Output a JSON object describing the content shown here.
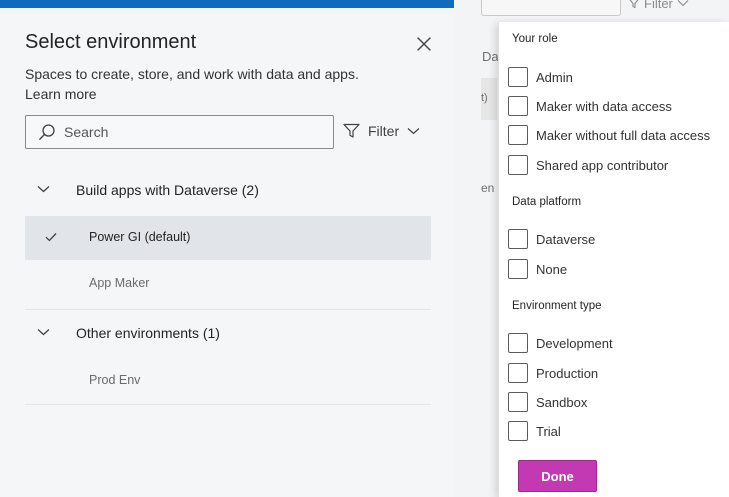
{
  "background": {
    "filter_label": "Filter",
    "column_header_fragment": "Da",
    "row_fragment_a": "t)",
    "row_fragment_b": "en"
  },
  "panel": {
    "title": "Select environment",
    "description": "Spaces to create, store, and work with data and apps.",
    "learn_more": "Learn more",
    "search": {
      "placeholder": "Search",
      "value": ""
    },
    "filter_label": "Filter",
    "groups": [
      {
        "label": "Build apps with Dataverse (2)",
        "items": [
          {
            "label": "Power GI (default)",
            "selected": true
          },
          {
            "label": "App Maker",
            "selected": false
          }
        ]
      },
      {
        "label": "Other environments (1)",
        "items": [
          {
            "label": "Prod Env",
            "selected": false
          }
        ]
      }
    ]
  },
  "filter": {
    "sections": [
      {
        "title": "Your role",
        "options": [
          "Admin",
          "Maker with data access",
          "Maker without full data access",
          "Shared app contributor"
        ]
      },
      {
        "title": "Data platform",
        "options": [
          "Dataverse",
          "None"
        ]
      },
      {
        "title": "Environment type",
        "options": [
          "Development",
          "Production",
          "Sandbox",
          "Trial"
        ]
      }
    ],
    "done_label": "Done"
  },
  "colors": {
    "accent_blue": "#0f6cbd",
    "done_button": "#c239b3",
    "selected_row": "#e1e4e8"
  },
  "icons": [
    "close-icon",
    "search-icon",
    "filter-icon",
    "chevron-down-icon",
    "checkmark-icon"
  ]
}
